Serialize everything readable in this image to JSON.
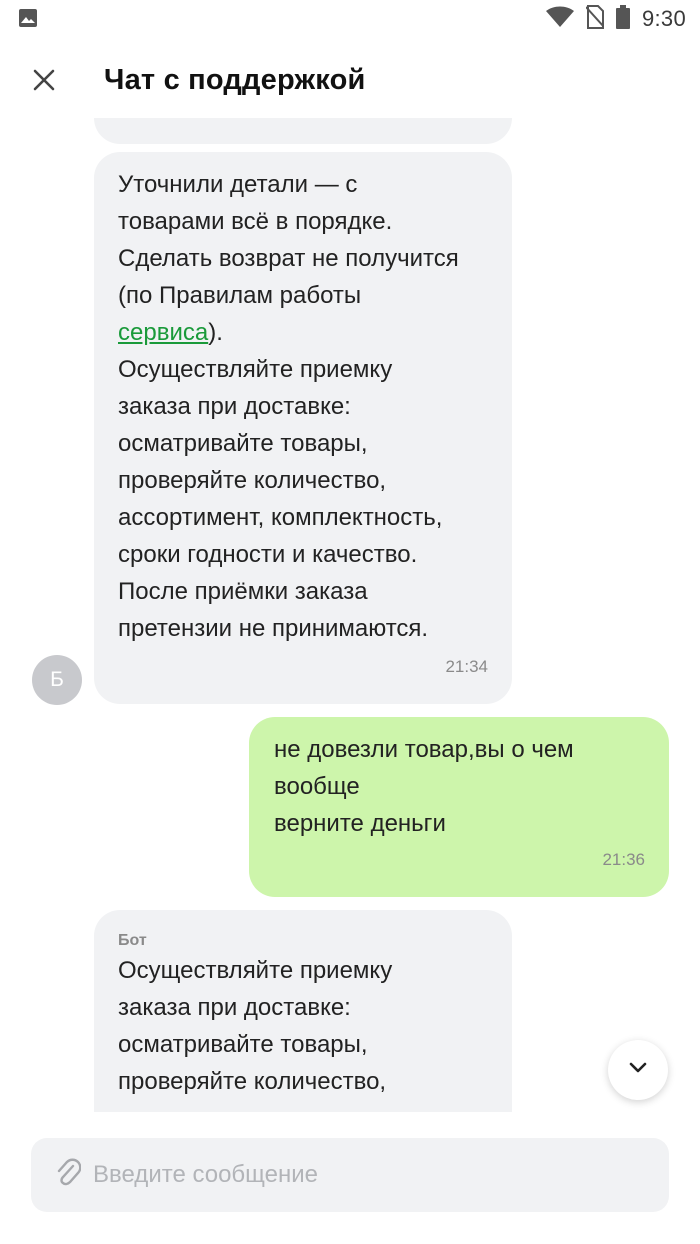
{
  "status_bar": {
    "time": "9:30",
    "icons": [
      "image-icon",
      "wifi-icon",
      "no-sim-icon",
      "battery-icon"
    ]
  },
  "header": {
    "title": "Чат с поддержкой",
    "close_icon": "close-icon"
  },
  "messages": [
    {
      "direction": "incoming",
      "text_before_link": "Уточнили детали — с\nтоварами всё в порядке.\nСделать возврат не получится\n(по Правилам работы\n",
      "link_text": "сервиса",
      "text_after_link": ").\nОсуществляйте приемку\nзаказа при доставке:\nосматривайте товары,\nпроверяйте количество,\nассортимент, комплектность,\nсроки годности и качество.\nПосле приёмки заказа\nпретензии не принимаются.",
      "time": "21:34",
      "avatar_letter": "Б"
    },
    {
      "direction": "outgoing",
      "text": "не довезли товар,вы о чем\nвообще\nверните деньги",
      "time": "21:36"
    },
    {
      "direction": "incoming",
      "sender": "Бот",
      "text": "Осуществляйте приемку\nзаказа при доставке:\nосматривайте товары,\nпроверяйте количество,"
    }
  ],
  "composer": {
    "placeholder": "Введите сообщение",
    "value": ""
  },
  "colors": {
    "incoming_bubble": "#f1f2f4",
    "outgoing_bubble": "#cdf5ab",
    "link": "#1a9a3a"
  }
}
